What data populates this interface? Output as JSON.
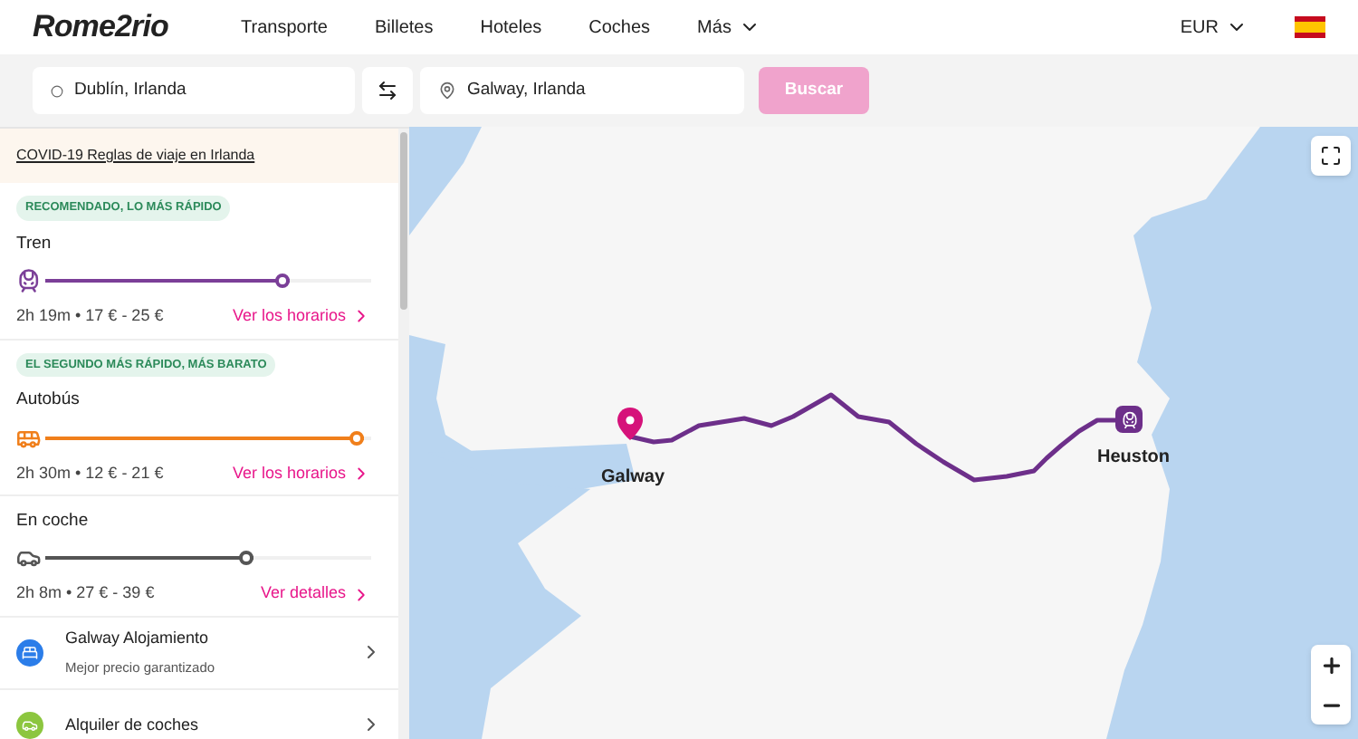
{
  "header": {
    "logo": "Rome2rio",
    "nav": [
      {
        "label": "Transporte",
        "dropdown": false
      },
      {
        "label": "Billetes",
        "dropdown": false
      },
      {
        "label": "Hoteles",
        "dropdown": false
      },
      {
        "label": "Coches",
        "dropdown": false
      },
      {
        "label": "Más",
        "dropdown": true
      }
    ],
    "currency": "EUR"
  },
  "search": {
    "from": "Dublín, Irlanda",
    "to": "Galway, Irlanda",
    "button": {
      "label": "Buscar",
      "disabled": true
    }
  },
  "sidebar": {
    "notice": "COVID-19 Reglas de viaje en Irlanda",
    "routes": [
      {
        "kind": "train",
        "badge": "RECOMENDADO, LO MÁS RÁPIDO",
        "title": "Tren",
        "level": 0.75,
        "color": "#7b3f98",
        "summary": "2h 19m • 17 € - 25 €",
        "link": "Ver los horarios"
      },
      {
        "kind": "bus",
        "badge": "EL SEGUNDO MÁS RÁPIDO, MÁS BARATO",
        "title": "Autobús",
        "level": 0.98,
        "color": "#f07f1b",
        "summary": "2h 30m • 12 € - 21 €",
        "link": "Ver los horarios"
      },
      {
        "kind": "car",
        "title": "En coche",
        "level": 0.64,
        "color": "#555555",
        "summary": "2h 8m • 27 € - 39 €",
        "link": "Ver detalles"
      }
    ],
    "offers": [
      {
        "kind": "hotel",
        "title": "Galway Alojamiento",
        "subtitle": "Mejor precio garantizado",
        "color": "#2b7de9"
      },
      {
        "kind": "car-rental",
        "title": "Alquiler de coches",
        "color": "#8cc63f"
      }
    ]
  },
  "map": {
    "origin_label": "Galway",
    "station_label": "Heuston"
  }
}
